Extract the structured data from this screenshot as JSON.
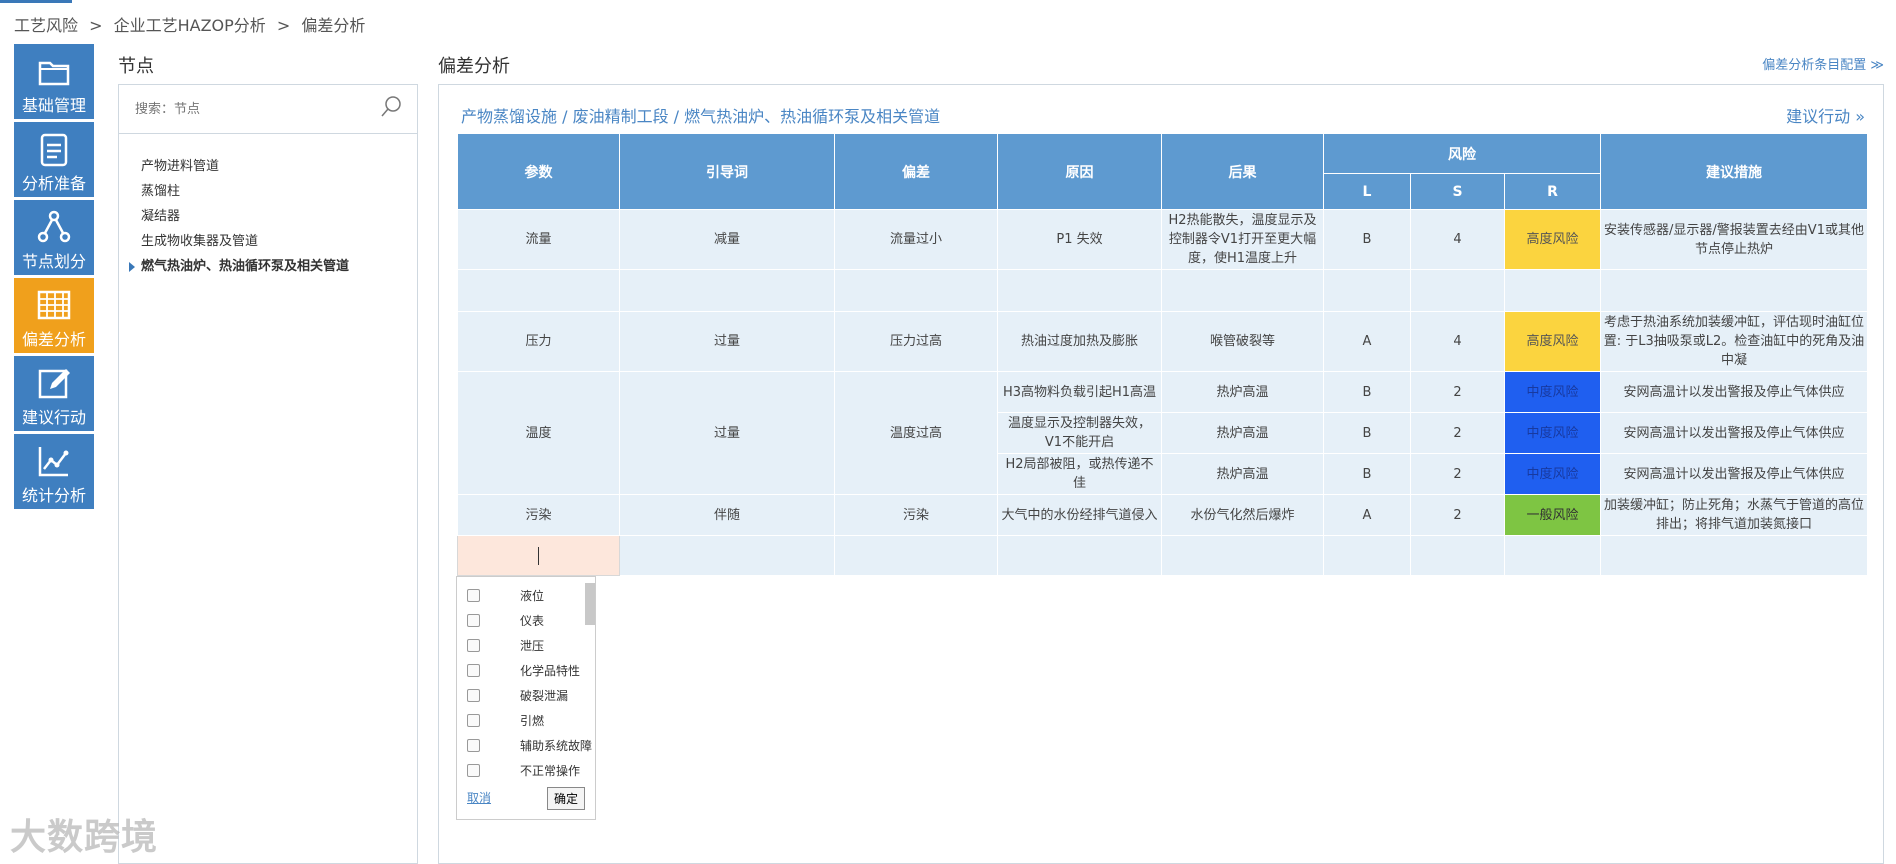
{
  "breadcrumb": [
    "工艺风险",
    ">",
    "企业工艺HAZOP分析",
    ">",
    "偏差分析"
  ],
  "sidebar": {
    "items": [
      {
        "label": "基础管理",
        "icon": "folder-icon"
      },
      {
        "label": "分析准备",
        "icon": "clipboard-icon"
      },
      {
        "label": "节点划分",
        "icon": "nodes-icon"
      },
      {
        "label": "偏差分析",
        "icon": "grid-icon",
        "active": true
      },
      {
        "label": "建议行动",
        "icon": "edit-icon"
      },
      {
        "label": "统计分析",
        "icon": "chart-icon"
      }
    ]
  },
  "node_panel": {
    "title": "节点",
    "search_placeholder": "搜索：节点",
    "nodes": [
      "产物进料管道",
      "蒸馏柱",
      "凝结器",
      "生成物收集器及管道",
      "燃气热油炉、热油循环泵及相关管道"
    ]
  },
  "main": {
    "title": "偏差分析",
    "config_link": "偏差分析条目配置 ≫",
    "path": "产物蒸馏设施 / 废油精制工段 / 燃气热油炉、热油循环泵及相关管道",
    "suggest_link": "建议行动 »",
    "headers": {
      "param": "参数",
      "guide": "引导词",
      "deviation": "偏差",
      "cause": "原因",
      "consequence": "后果",
      "risk": "风险",
      "l": "L",
      "s": "S",
      "r": "R",
      "measure": "建议措施"
    },
    "rows": {
      "flow": {
        "param": "流量",
        "guide": "减量",
        "deviation": "流量过小",
        "cause": "P1 失效",
        "consequence": "H2热能散失，温度显示及控制器令V1打开至更大幅度，使H1温度上升",
        "l": "B",
        "s": "4",
        "r": "高度风险",
        "measure": "安装传感器/显示器/警报装置去经由V1或其他节点停止热炉"
      },
      "pressure": {
        "param": "压力",
        "guide": "过量",
        "deviation": "压力过高",
        "cause": "热油过度加热及膨胀",
        "consequence": "喉管破裂等",
        "l": "A",
        "s": "4",
        "r": "高度风险",
        "measure": "考虑于热油系统加装缓冲缸，评估现时油缸位置: 于L3抽吸泵或L2。检查油缸中的死角及油中凝"
      },
      "temp": {
        "param": "温度",
        "guide": "过量",
        "deviation": "温度过高",
        "sub": [
          {
            "cause": "H3高物料负载引起H1高温",
            "consequence": "热炉高温",
            "l": "B",
            "s": "2",
            "r": "中度风险",
            "measure": "安网高温计以发出警报及停止气体供应"
          },
          {
            "cause": "温度显示及控制器失效，V1不能开启",
            "consequence": "热炉高温",
            "l": "B",
            "s": "2",
            "r": "中度风险",
            "measure": "安网高温计以发出警报及停止气体供应"
          },
          {
            "cause": "H2局部被阻，或热传递不佳",
            "consequence": "热炉高温",
            "l": "B",
            "s": "2",
            "r": "中度风险",
            "measure": "安网高温计以发出警报及停止气体供应"
          }
        ]
      },
      "pollution": {
        "param": "污染",
        "guide": "伴随",
        "deviation": "污染",
        "cause": "大气中的水份经排气道侵入",
        "consequence": "水份气化然后爆炸",
        "l": "A",
        "s": "2",
        "r": "一般风险",
        "measure": "加装缓冲缸；防止死角；水蒸气于管道的高位排出；将排气道加装氮接口"
      }
    }
  },
  "dropdown": {
    "options": [
      "液位",
      "仪表",
      "泄压",
      "化学品特性",
      "破裂泄漏",
      "引燃",
      "辅助系统故障",
      "不正常操作"
    ],
    "cancel": "取消",
    "ok": "确定"
  },
  "watermark": "大数跨境",
  "colors": {
    "accent": "#3f7fc0",
    "active": "#f0a01c",
    "header": "#5e9ad0",
    "high": "#fbd43f",
    "mid": "#1f5ff0",
    "low": "#7ec543"
  }
}
